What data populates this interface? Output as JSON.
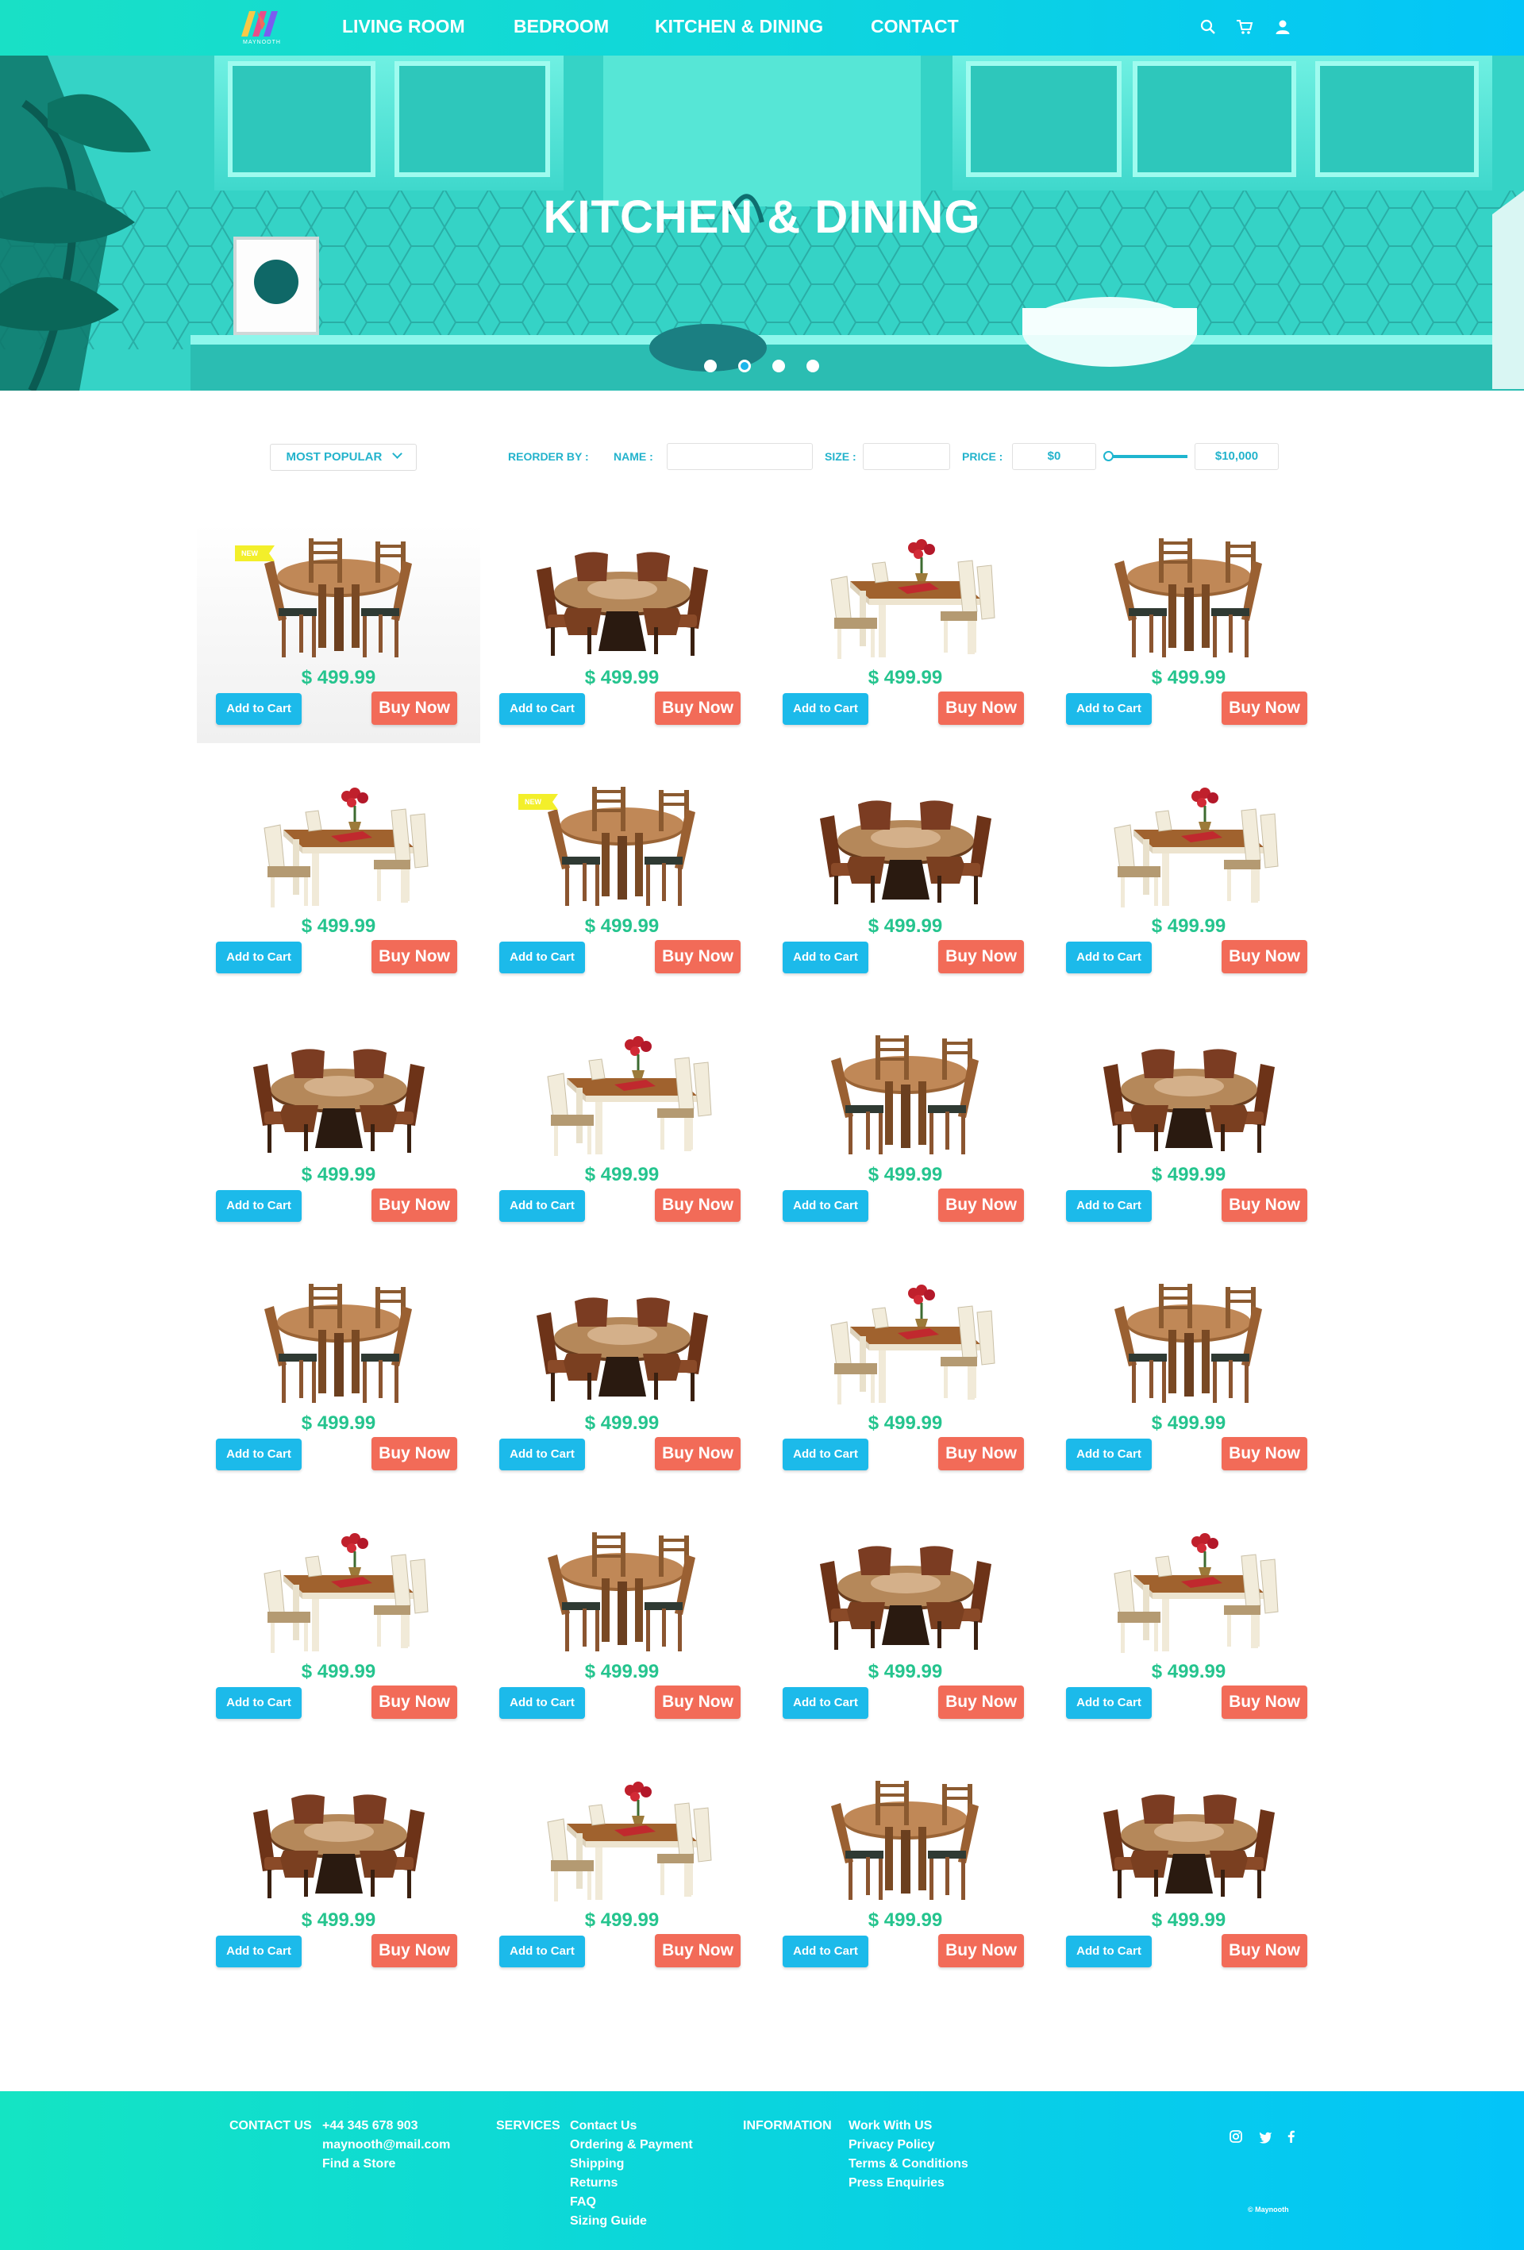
{
  "header": {
    "logo_text": "MAYNOOTH",
    "nav": [
      "LIVING ROOM",
      "BEDROOM",
      "KITCHEN & DINING",
      "CONTACT"
    ],
    "icons": [
      "search-icon",
      "cart-icon",
      "user-icon"
    ]
  },
  "hero": {
    "title": "KITCHEN & DINING",
    "slides": 4,
    "active_slide": 2
  },
  "filters": {
    "sort": "MOST POPULAR",
    "reorder_label": "REORDER BY :",
    "name_label": "NAME :",
    "size_label": "SIZE :",
    "price_label": "PRICE :",
    "price_min": "$0",
    "price_max": "$10,000"
  },
  "product_labels": {
    "add_to_cart": "Add to Cart",
    "buy_now": "Buy Now",
    "new_badge": "NEW"
  },
  "products": [
    {
      "variant": "round-brown",
      "price": "$ 499.99",
      "badge": true,
      "featured": true
    },
    {
      "variant": "lazy-susan",
      "price": "$ 499.99",
      "badge": false,
      "featured": false
    },
    {
      "variant": "white-rect",
      "price": "$ 499.99",
      "badge": false,
      "featured": false
    },
    {
      "variant": "round-brown",
      "price": "$ 499.99",
      "badge": false,
      "featured": false
    },
    {
      "variant": "white-rect",
      "price": "$ 499.99",
      "badge": false,
      "featured": false
    },
    {
      "variant": "round-brown",
      "price": "$ 499.99",
      "badge": true,
      "featured": false
    },
    {
      "variant": "lazy-susan",
      "price": "$ 499.99",
      "badge": false,
      "featured": false
    },
    {
      "variant": "white-rect",
      "price": "$ 499.99",
      "badge": false,
      "featured": false
    },
    {
      "variant": "lazy-susan",
      "price": "$ 499.99",
      "badge": false,
      "featured": false
    },
    {
      "variant": "white-rect",
      "price": "$ 499.99",
      "badge": false,
      "featured": false
    },
    {
      "variant": "round-brown",
      "price": "$ 499.99",
      "badge": false,
      "featured": false
    },
    {
      "variant": "lazy-susan",
      "price": "$ 499.99",
      "badge": false,
      "featured": false
    },
    {
      "variant": "round-brown",
      "price": "$ 499.99",
      "badge": false,
      "featured": false
    },
    {
      "variant": "lazy-susan",
      "price": "$ 499.99",
      "badge": false,
      "featured": false
    },
    {
      "variant": "white-rect",
      "price": "$ 499.99",
      "badge": false,
      "featured": false
    },
    {
      "variant": "round-brown",
      "price": "$ 499.99",
      "badge": false,
      "featured": false
    },
    {
      "variant": "white-rect",
      "price": "$ 499.99",
      "badge": false,
      "featured": false
    },
    {
      "variant": "round-brown",
      "price": "$ 499.99",
      "badge": false,
      "featured": false
    },
    {
      "variant": "lazy-susan",
      "price": "$ 499.99",
      "badge": false,
      "featured": false
    },
    {
      "variant": "white-rect",
      "price": "$ 499.99",
      "badge": false,
      "featured": false
    },
    {
      "variant": "lazy-susan",
      "price": "$ 499.99",
      "badge": false,
      "featured": false
    },
    {
      "variant": "white-rect",
      "price": "$ 499.99",
      "badge": false,
      "featured": false
    },
    {
      "variant": "round-brown",
      "price": "$ 499.99",
      "badge": false,
      "featured": false
    },
    {
      "variant": "lazy-susan",
      "price": "$ 499.99",
      "badge": false,
      "featured": false
    }
  ],
  "footer": {
    "contact_heading": "CONTACT US",
    "contact_items": [
      "+44 345 678 903",
      "maynooth@mail.com",
      "Find a Store"
    ],
    "services_heading": "SERVICES",
    "services_items": [
      "Contact Us",
      "Ordering & Payment",
      "Shipping",
      "Returns",
      "FAQ",
      "Sizing Guide"
    ],
    "information_heading": "INFORMATION",
    "information_items": [
      "Work With US",
      "Privacy Policy",
      "Terms & Conditions",
      "Press Enquiries"
    ],
    "social_icons": [
      "instagram-icon",
      "twitter-icon",
      "facebook-icon"
    ],
    "copyright": "© Maynooth"
  }
}
